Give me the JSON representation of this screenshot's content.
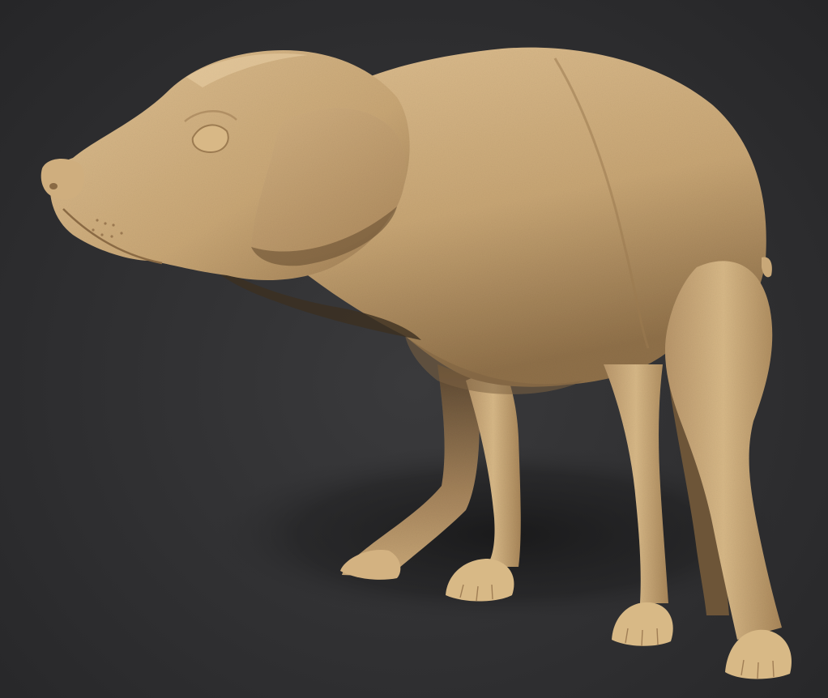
{
  "scene": {
    "subject": "dog-sculpt",
    "colors": {
      "background": "#2f2f31",
      "clay_light": "#d9bb8e",
      "clay_mid": "#bf9c6b",
      "clay_dark": "#7e6342",
      "shadow": "#1c1c1d"
    }
  }
}
